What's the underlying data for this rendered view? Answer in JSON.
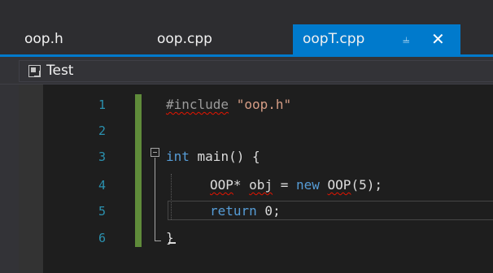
{
  "tabs": [
    {
      "label": "oop.h"
    },
    {
      "label": "oop.cpp"
    },
    {
      "label": "oopT.cpp",
      "pin_icon": "pin-icon",
      "close_icon": "close-icon"
    }
  ],
  "nav": {
    "scope_icon": "project-scope-icon",
    "scope_label": "Test"
  },
  "editor": {
    "line_numbers": [
      "1",
      "2",
      "3",
      "4",
      "5",
      "6"
    ],
    "lines": {
      "l1": {
        "directive": "#include",
        "sp": " ",
        "str": "\"oop.h\""
      },
      "l3": {
        "kw": "int",
        "rest": " main() {"
      },
      "l4": {
        "type": "OOP",
        "star": "* ",
        "var": "obj",
        "eq": " = ",
        "kw": "new",
        "sp": " ",
        "ctor": "OOP",
        "args": "(5);"
      },
      "l5": {
        "kw": "return",
        "rest": " 0;"
      },
      "l6": {
        "brace": "}"
      }
    }
  },
  "colors": {
    "accent": "#007acc",
    "keyword": "#569cd6",
    "string": "#d69d85",
    "line_number": "#2b91af",
    "change_bar": "#5f8b3a",
    "error_squiggle": "#e51400"
  }
}
